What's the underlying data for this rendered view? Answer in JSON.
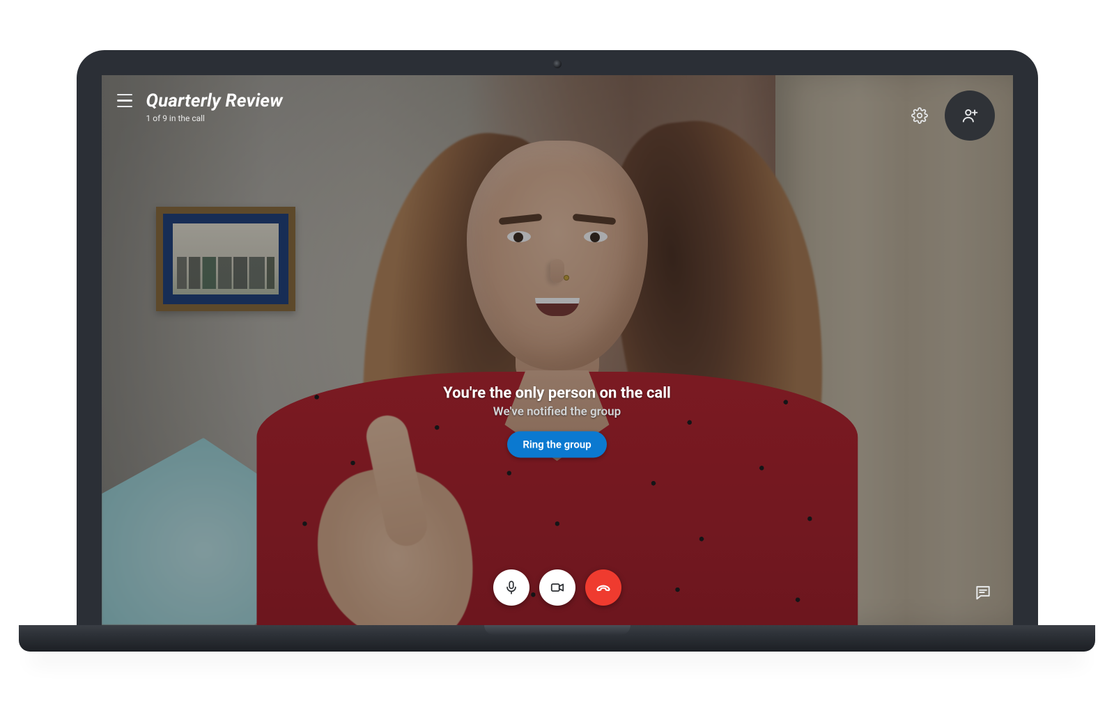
{
  "header": {
    "title": "Quarterly Review",
    "subtitle": "1 of 9 in the call"
  },
  "notice": {
    "heading": "You're the only person on the call",
    "subheading": "We've notified the group",
    "cta_label": "Ring the group"
  },
  "colors": {
    "accent": "#0b79d0",
    "hangup": "#ef3b2f"
  }
}
